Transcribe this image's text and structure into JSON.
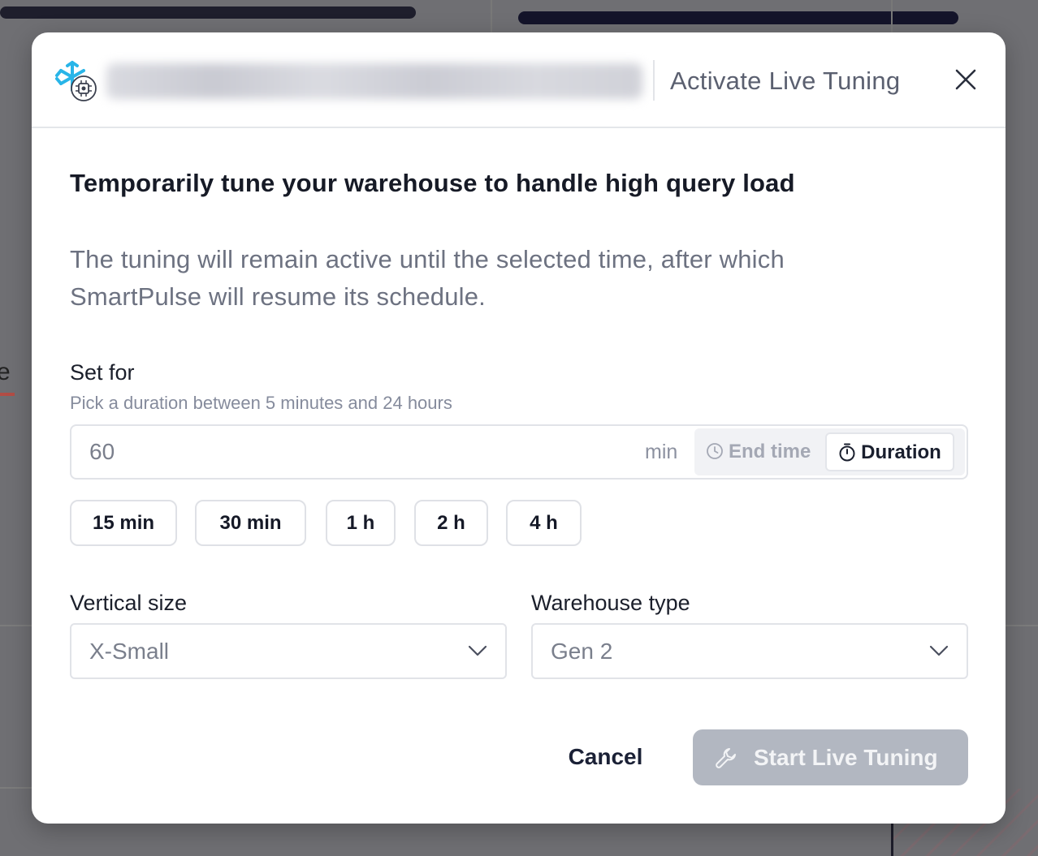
{
  "modal": {
    "header_title": "Activate Live Tuning",
    "heading": "Temporarily tune your warehouse to handle high query load",
    "description": "The tuning will remain active until the selected time, after which SmartPulse will resume its schedule.",
    "set_for": {
      "label": "Set for",
      "hint": "Pick a duration between 5 minutes and 24 hours",
      "value": "60",
      "unit": "min",
      "toggle_end_time": "End time",
      "toggle_duration": "Duration",
      "active_mode": "Duration"
    },
    "presets": [
      "15 min",
      "30 min",
      "1 h",
      "2 h",
      "4 h"
    ],
    "vertical_size": {
      "label": "Vertical size",
      "value": "X-Small"
    },
    "warehouse_type": {
      "label": "Warehouse type",
      "value": "Gen 2"
    },
    "actions": {
      "cancel": "Cancel",
      "start": "Start Live Tuning",
      "start_disabled": true
    }
  },
  "colors": {
    "accent_logo": "#29b5e8",
    "primary_text": "#161a26",
    "muted_text": "#6d7281",
    "disabled_button": "#b2b7c1",
    "backdrop": "#6f6f73"
  },
  "icons": {
    "logo": "snowflake-chip-icon",
    "close": "close-icon",
    "end_time": "clock-icon",
    "duration": "stopwatch-icon",
    "dropdown": "chevron-down-icon",
    "start": "wrench-icon"
  }
}
